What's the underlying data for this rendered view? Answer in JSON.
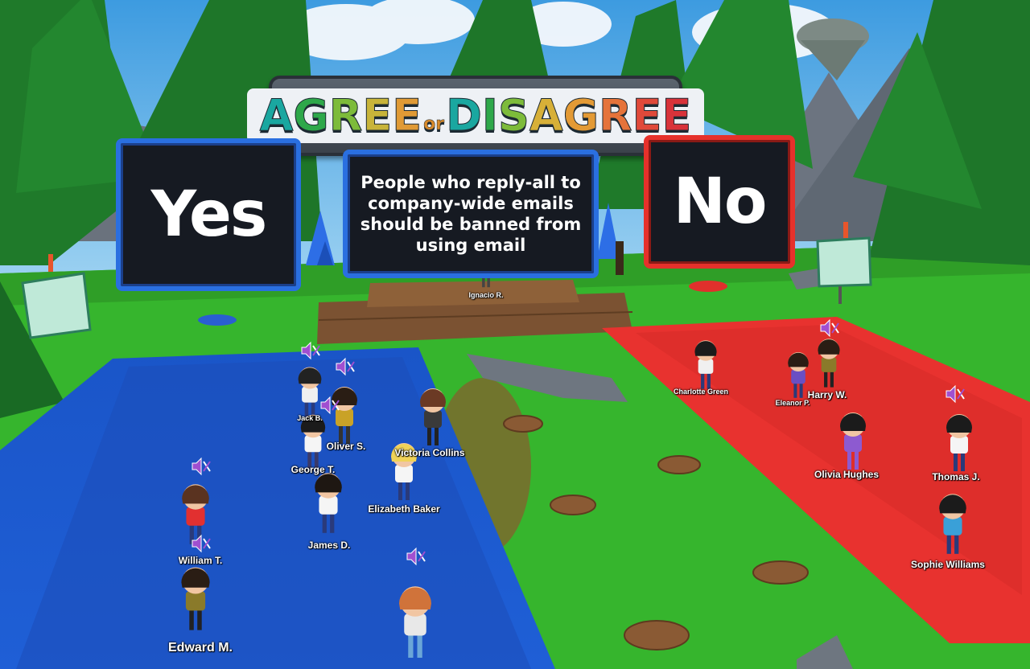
{
  "title": {
    "letters": [
      {
        "t": "A",
        "c": "#1aa7a0"
      },
      {
        "t": "G",
        "c": "#2ea84a"
      },
      {
        "t": "R",
        "c": "#7dbb3a"
      },
      {
        "t": "E",
        "c": "#c8b43a"
      },
      {
        "t": "E",
        "c": "#e09a35"
      },
      {
        "t": "or",
        "c": "#d88a2a",
        "small": true
      },
      {
        "t": "D",
        "c": "#1aa7a0"
      },
      {
        "t": "I",
        "c": "#2ea84a"
      },
      {
        "t": "S",
        "c": "#7dbb3a"
      },
      {
        "t": "A",
        "c": "#d7b038"
      },
      {
        "t": "G",
        "c": "#e39a35"
      },
      {
        "t": "R",
        "c": "#e5733a"
      },
      {
        "t": "E",
        "c": "#e0493a"
      },
      {
        "t": "E",
        "c": "#d8333a"
      }
    ]
  },
  "boards": {
    "yes_label": "Yes",
    "no_label": "No",
    "question": "People who reply-all to company-wide emails should be banned from using email"
  },
  "colors": {
    "yes_zone": "#1f5fd6",
    "no_zone": "#e8322f",
    "grass": "#36b52d",
    "yes_border": "#2a6fe0",
    "no_border": "#e6312b"
  },
  "host": {
    "name": "Ignacio R."
  },
  "players": [
    {
      "name": "Jack B.",
      "size": "small",
      "zone": "yes",
      "muted": true
    },
    {
      "name": "Oliver S.",
      "size": "normal",
      "zone": "yes",
      "muted": true
    },
    {
      "name": "George T.",
      "size": "normal",
      "zone": "yes",
      "muted": true
    },
    {
      "name": "Victoria Collins",
      "size": "normal",
      "zone": "yes",
      "muted": false
    },
    {
      "name": "Elizabeth Baker",
      "size": "normal",
      "zone": "yes",
      "muted": false
    },
    {
      "name": "James D.",
      "size": "normal",
      "zone": "yes",
      "muted": false
    },
    {
      "name": "William T.",
      "size": "normal",
      "zone": "yes",
      "muted": true
    },
    {
      "name": "Edward M.",
      "size": "big",
      "zone": "yes",
      "muted": true
    },
    {
      "name": "Unnamed",
      "size": "normal",
      "zone": "yes",
      "muted": true,
      "hidden_label": true
    },
    {
      "name": "Charlotte Green",
      "size": "small",
      "zone": "no",
      "muted": false
    },
    {
      "name": "Eleanor P.",
      "size": "small",
      "zone": "no",
      "muted": false
    },
    {
      "name": "Harry W.",
      "size": "small",
      "zone": "no",
      "muted": true
    },
    {
      "name": "Olivia Hughes",
      "size": "normal",
      "zone": "no",
      "muted": false
    },
    {
      "name": "Thomas J.",
      "size": "normal",
      "zone": "no",
      "muted": true
    },
    {
      "name": "Sophie Williams",
      "size": "normal",
      "zone": "no",
      "muted": false
    }
  ],
  "icons": [
    "muted-speaker-icon",
    "info-sign-icon"
  ]
}
